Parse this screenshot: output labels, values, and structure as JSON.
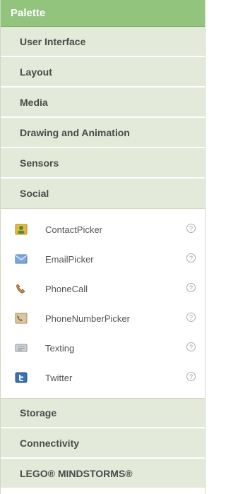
{
  "palette": {
    "title": "Palette",
    "categories_top": [
      {
        "label": "User Interface"
      },
      {
        "label": "Layout"
      },
      {
        "label": "Media"
      },
      {
        "label": "Drawing and Animation"
      },
      {
        "label": "Sensors"
      },
      {
        "label": "Social"
      }
    ],
    "social_components": [
      {
        "label": "ContactPicker",
        "icon": "contact-picker-icon",
        "help": "?"
      },
      {
        "label": "EmailPicker",
        "icon": "email-picker-icon",
        "help": "?"
      },
      {
        "label": "PhoneCall",
        "icon": "phone-call-icon",
        "help": "?"
      },
      {
        "label": "PhoneNumberPicker",
        "icon": "phone-number-picker-icon",
        "help": "?"
      },
      {
        "label": "Texting",
        "icon": "texting-icon",
        "help": "?"
      },
      {
        "label": "Twitter",
        "icon": "twitter-icon",
        "help": "?"
      }
    ],
    "categories_bottom": [
      {
        "label": "Storage"
      },
      {
        "label": "Connectivity"
      },
      {
        "label": "LEGO® MINDSTORMS®"
      }
    ]
  },
  "colors": {
    "header_bg": "#93c47d",
    "category_bg": "#e3ead9"
  }
}
